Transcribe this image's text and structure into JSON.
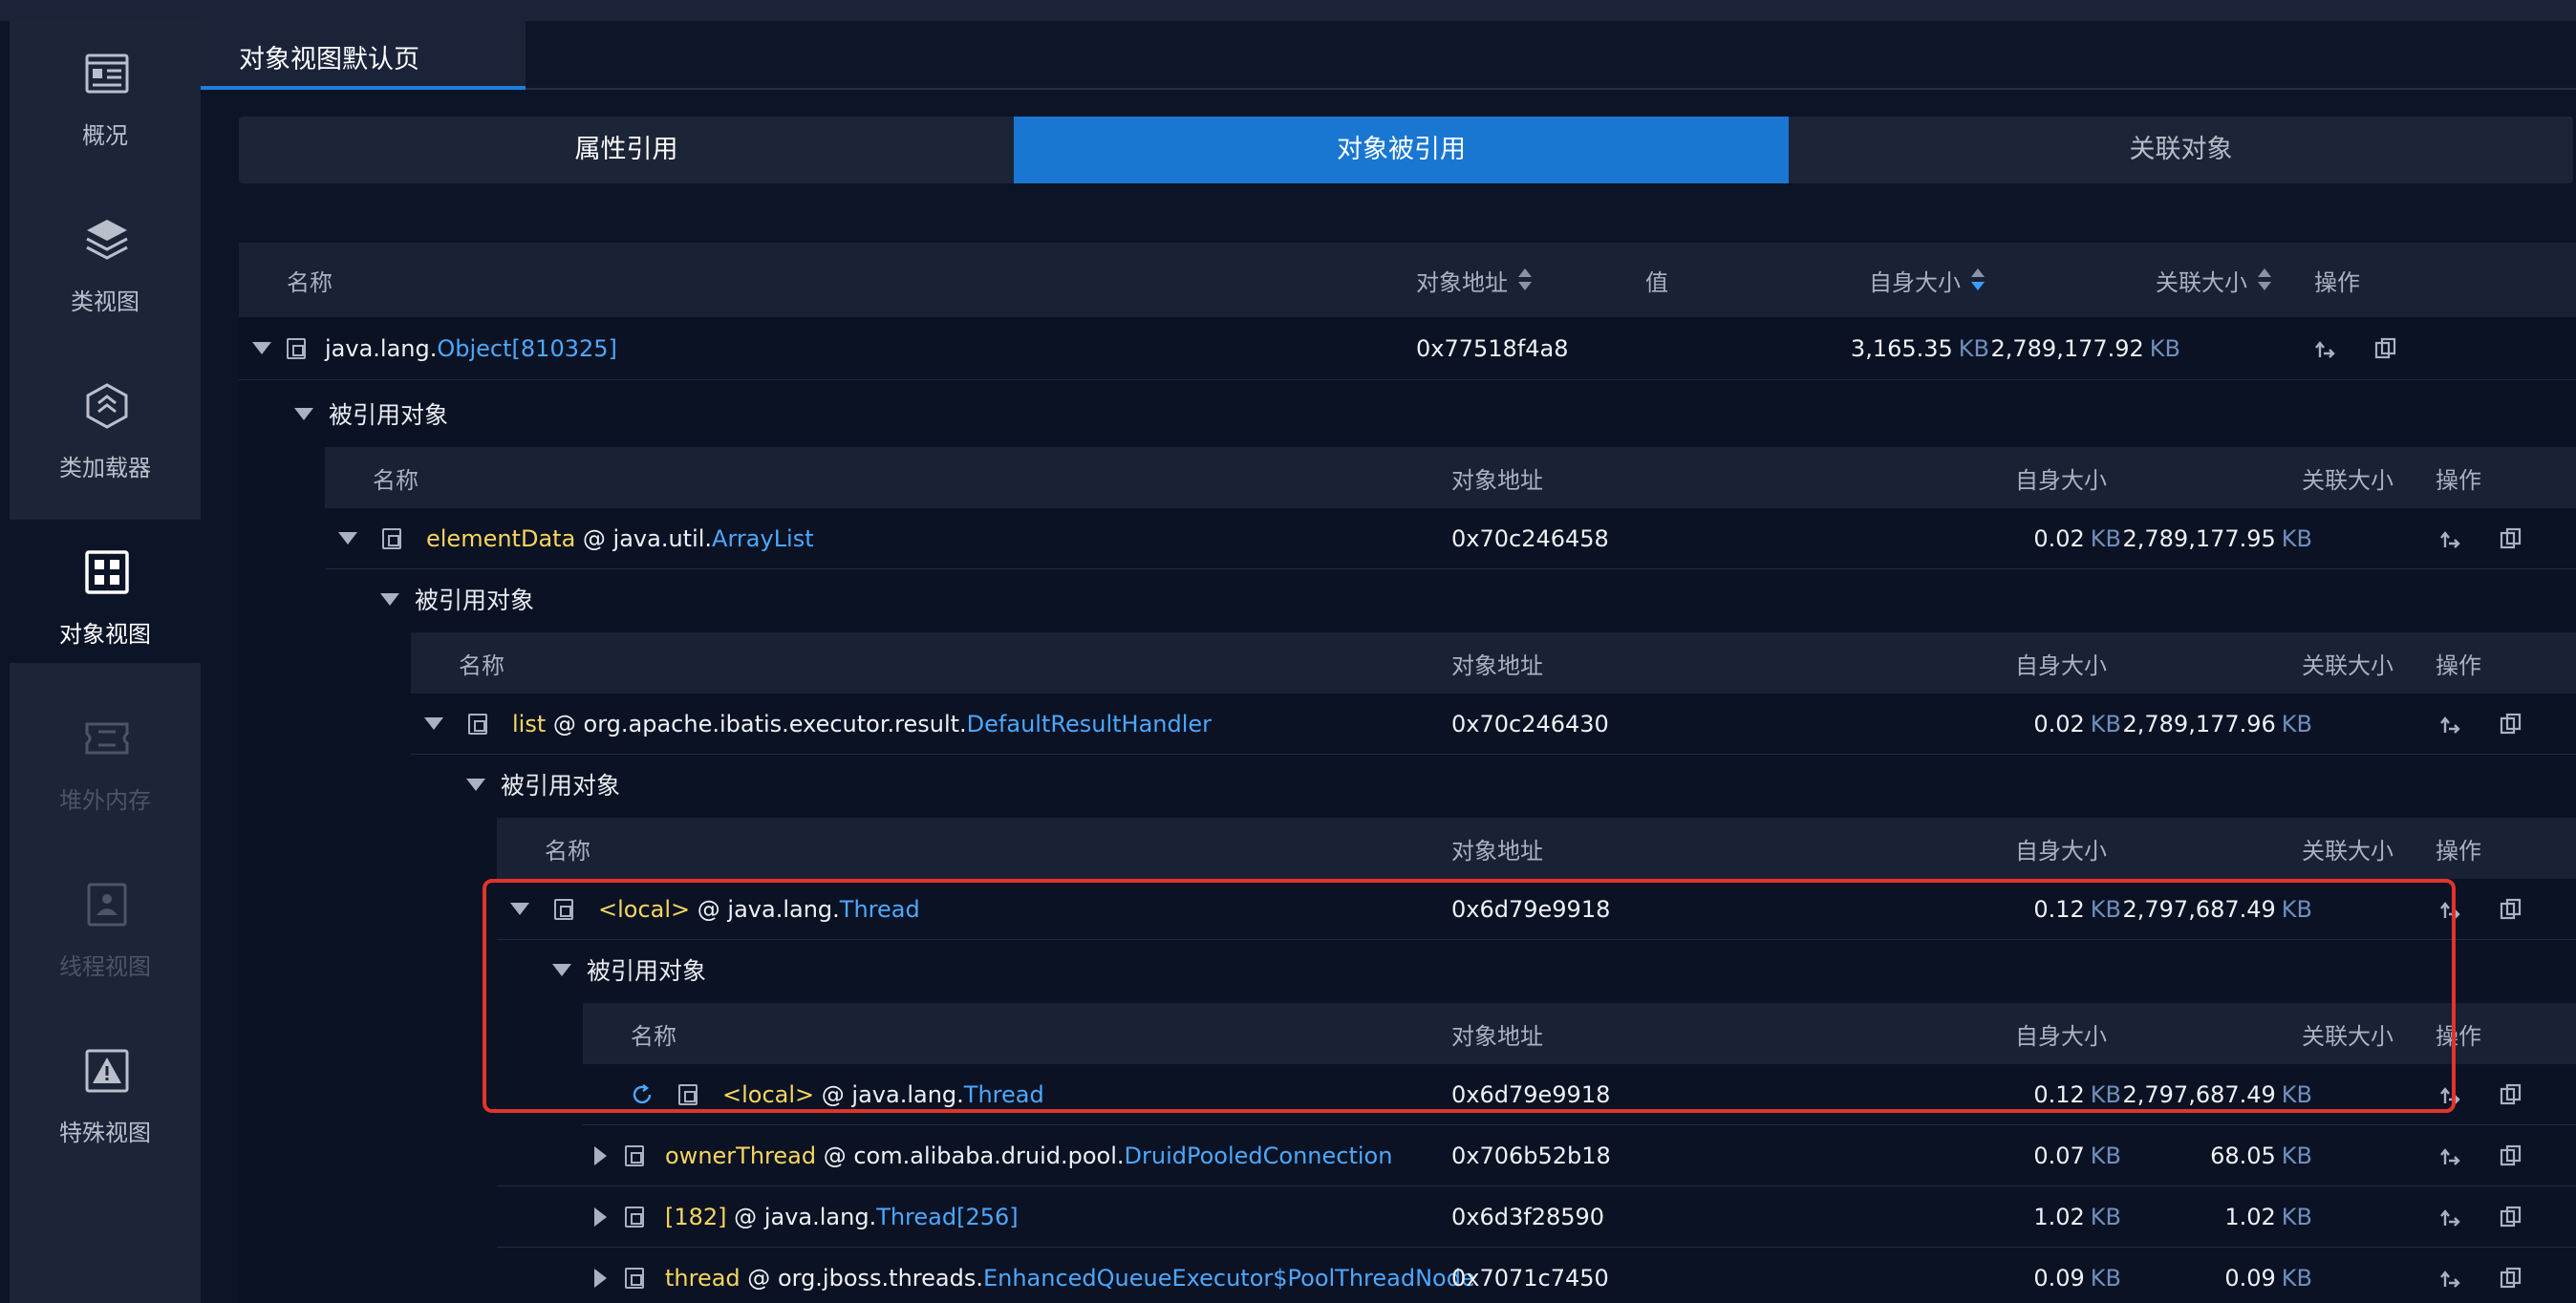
{
  "sidebar": {
    "items": [
      {
        "label": "概况",
        "icon": "overview-icon",
        "state": "normal"
      },
      {
        "label": "类视图",
        "icon": "layers-icon",
        "state": "normal"
      },
      {
        "label": "类加载器",
        "icon": "class-loader-icon",
        "state": "normal"
      },
      {
        "label": "对象视图",
        "icon": "grid-icon",
        "state": "active"
      },
      {
        "label": "堆外内存",
        "icon": "memory-icon",
        "state": "disabled"
      },
      {
        "label": "线程视图",
        "icon": "thread-icon",
        "state": "disabled"
      },
      {
        "label": "特殊视图",
        "icon": "warning-icon",
        "state": "normal"
      }
    ]
  },
  "doc_tab": {
    "label": "对象视图默认页"
  },
  "segments": [
    {
      "label": "属性引用",
      "active": false
    },
    {
      "label": "对象被引用",
      "active": true
    },
    {
      "label": "关联对象",
      "active": false
    }
  ],
  "main_header": {
    "name": "名称",
    "address": "对象地址",
    "value": "值",
    "self_size": "自身大小",
    "retained_size": "关联大小",
    "ops": "操作"
  },
  "nested_header": {
    "name": "名称",
    "address": "对象地址",
    "self_size": "自身大小",
    "retained_size": "关联大小",
    "ops": "操作"
  },
  "group_label": "被引用对象",
  "unit": "KB",
  "root": {
    "pkg": "java.lang.",
    "cls": "Object[810325]",
    "address": "0x77518f4a8",
    "self": "3,165.35",
    "retained": "2,789,177.92"
  },
  "rows": [
    {
      "field": "elementData",
      "sep": " @ ",
      "pkg": "java.util.",
      "cls": "ArrayList",
      "address": "0x70c246458",
      "self": "0.02",
      "retained": "2,789,177.95"
    },
    {
      "field": "list",
      "sep": " @ ",
      "pkg": "org.apache.ibatis.executor.result.",
      "cls": "DefaultResultHandler",
      "address": "0x70c246430",
      "self": "0.02",
      "retained": "2,789,177.96"
    },
    {
      "field": "<local>",
      "sep": " @ ",
      "pkg": "java.lang.",
      "cls": "Thread",
      "address": "0x6d79e9918",
      "self": "0.12",
      "retained": "2,797,687.49"
    },
    {
      "field": "<local>",
      "sep": " @ ",
      "pkg": "java.lang.",
      "cls": "Thread",
      "address": "0x6d79e9918",
      "self": "0.12",
      "retained": "2,797,687.49"
    },
    {
      "field": "ownerThread",
      "sep": " @ ",
      "pkg": "com.alibaba.druid.pool.",
      "cls": "DruidPooledConnection",
      "address": "0x706b52b18",
      "self": "0.07",
      "retained": "68.05"
    },
    {
      "field": "[182]",
      "sep": " @ ",
      "pkg": "java.lang.",
      "cls": "Thread[256]",
      "address": "0x6d3f28590",
      "self": "1.02",
      "retained": "1.02"
    },
    {
      "field": "thread",
      "sep": " @ ",
      "pkg": "org.jboss.threads.",
      "cls": "EnhancedQueueExecutor$PoolThreadNode",
      "address": "0x7071c7450",
      "self": "0.09",
      "retained": "0.09"
    }
  ]
}
